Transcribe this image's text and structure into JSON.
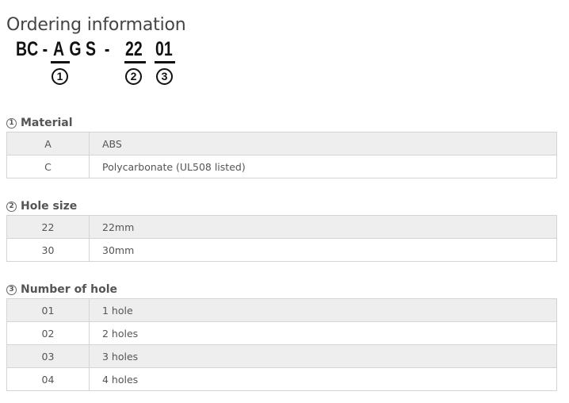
{
  "title": "Ordering information",
  "code": {
    "prefix": "BC - ",
    "material_char": "A",
    "suffix": " G S  - ",
    "hole_size": "22",
    "hole_count": "01",
    "markers": [
      "1",
      "2",
      "3"
    ]
  },
  "sections": [
    {
      "marker": "1",
      "heading": "Material",
      "rows": [
        {
          "code": "A",
          "desc": "ABS"
        },
        {
          "code": "C",
          "desc": "Polycarbonate (UL508 listed)"
        }
      ]
    },
    {
      "marker": "2",
      "heading": "Hole size",
      "rows": [
        {
          "code": "22",
          "desc": "22mm"
        },
        {
          "code": "30",
          "desc": "30mm"
        }
      ]
    },
    {
      "marker": "3",
      "heading": "Number of hole",
      "rows": [
        {
          "code": "01",
          "desc": "1 hole"
        },
        {
          "code": "02",
          "desc": "2 holes"
        },
        {
          "code": "03",
          "desc": "3 holes"
        },
        {
          "code": "04",
          "desc": "4 holes"
        }
      ]
    }
  ]
}
